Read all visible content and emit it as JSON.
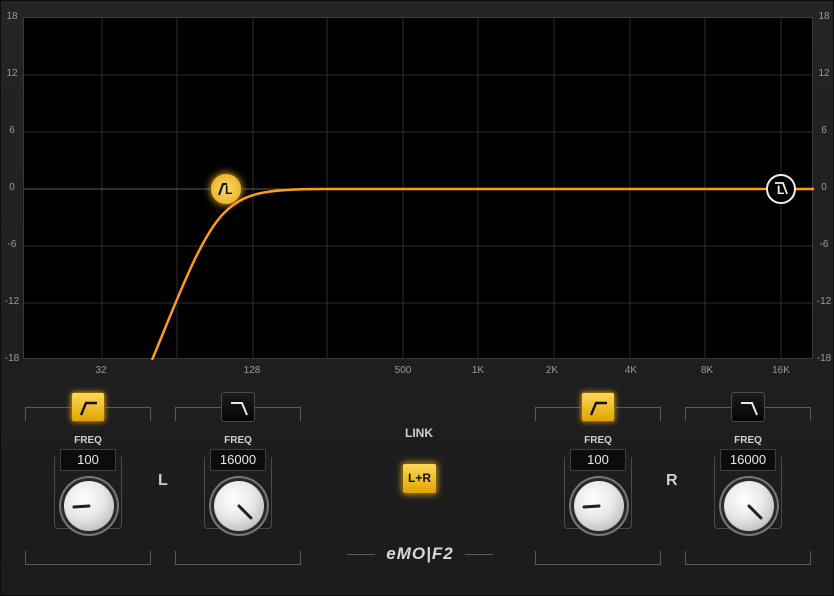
{
  "graph": {
    "db_labels": [
      "18",
      "12",
      "6",
      "0",
      "-6",
      "-12",
      "-18"
    ],
    "freq_labels": [
      "32",
      "128",
      "500",
      "1K",
      "2K",
      "4K",
      "8K",
      "16K"
    ],
    "handle_low_letter": "L",
    "handle_high_letter": "L"
  },
  "left": {
    "label": "L",
    "highpass": {
      "state": "on",
      "freq_caption": "FREQ",
      "freq_value": "100"
    },
    "lowpass": {
      "state": "off",
      "freq_caption": "FREQ",
      "freq_value": "16000"
    }
  },
  "right": {
    "label": "R",
    "highpass": {
      "state": "on",
      "freq_caption": "FREQ",
      "freq_value": "100"
    },
    "lowpass": {
      "state": "off",
      "freq_caption": "FREQ",
      "freq_value": "16000"
    }
  },
  "link": {
    "caption": "LINK",
    "button_label": "L+R",
    "state": "on"
  },
  "logo": {
    "text": "eMO|F2"
  },
  "colors": {
    "curve": "#ff9a1a",
    "accent": "#f0b92a",
    "grid": "#2e2e2e"
  },
  "icons": {
    "highpass": "highpass-filter-icon",
    "lowpass": "lowpass-filter-icon"
  }
}
